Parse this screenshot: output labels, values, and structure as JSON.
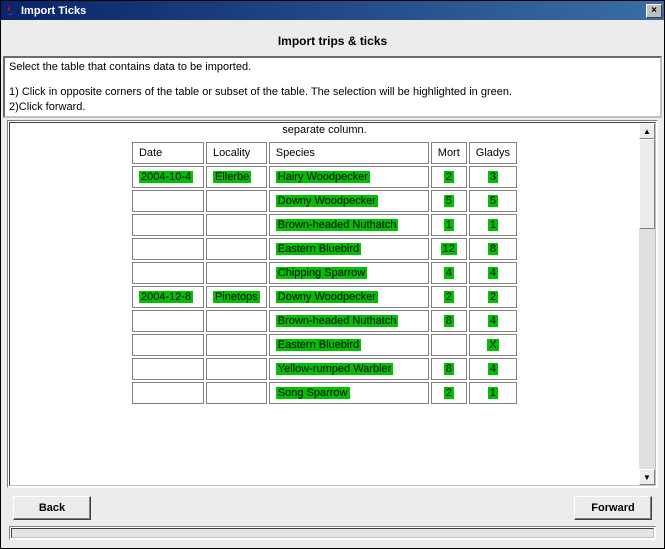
{
  "window": {
    "title": "Import Ticks"
  },
  "heading": "Import trips & ticks",
  "instructions": {
    "intro": "Select the table that contains data to be imported.",
    "step1": "1) Click in opposite corners of the table or subset of the table. The selection will be highlighted in green.",
    "step2": "2)Click forward."
  },
  "truncated_text": "separate column.",
  "table": {
    "headers": [
      "Date",
      "Locality",
      "Species",
      "Mort",
      "Gladys"
    ],
    "rows": [
      {
        "date": "2004-10-4",
        "locality": "Ellerbe",
        "species": "Hairy Woodpecker",
        "mort": "2",
        "gladys": "3"
      },
      {
        "date": "",
        "locality": "",
        "species": "Downy Woodpecker",
        "mort": "5",
        "gladys": "5"
      },
      {
        "date": "",
        "locality": "",
        "species": "Brown-headed Nuthatch",
        "mort": "1",
        "gladys": "1"
      },
      {
        "date": "",
        "locality": "",
        "species": "Eastern Bluebird",
        "mort": "12",
        "gladys": "8"
      },
      {
        "date": "",
        "locality": "",
        "species": "Chipping Sparrow",
        "mort": "4",
        "gladys": "4"
      },
      {
        "date": "2004-12-8",
        "locality": "Pinetops",
        "species": "Downy Woodpecker",
        "mort": "2",
        "gladys": "2"
      },
      {
        "date": "",
        "locality": "",
        "species": "Brown-headed Nuthatch",
        "mort": "8",
        "gladys": "4"
      },
      {
        "date": "",
        "locality": "",
        "species": "Eastern Bluebird",
        "mort": "",
        "gladys": "X"
      },
      {
        "date": "",
        "locality": "",
        "species": "Yellow-rumped Warbler",
        "mort": "8",
        "gladys": "4"
      },
      {
        "date": "",
        "locality": "",
        "species": "Song Sparrow",
        "mort": "2",
        "gladys": "1"
      }
    ]
  },
  "buttons": {
    "back": "Back",
    "forward": "Forward"
  }
}
